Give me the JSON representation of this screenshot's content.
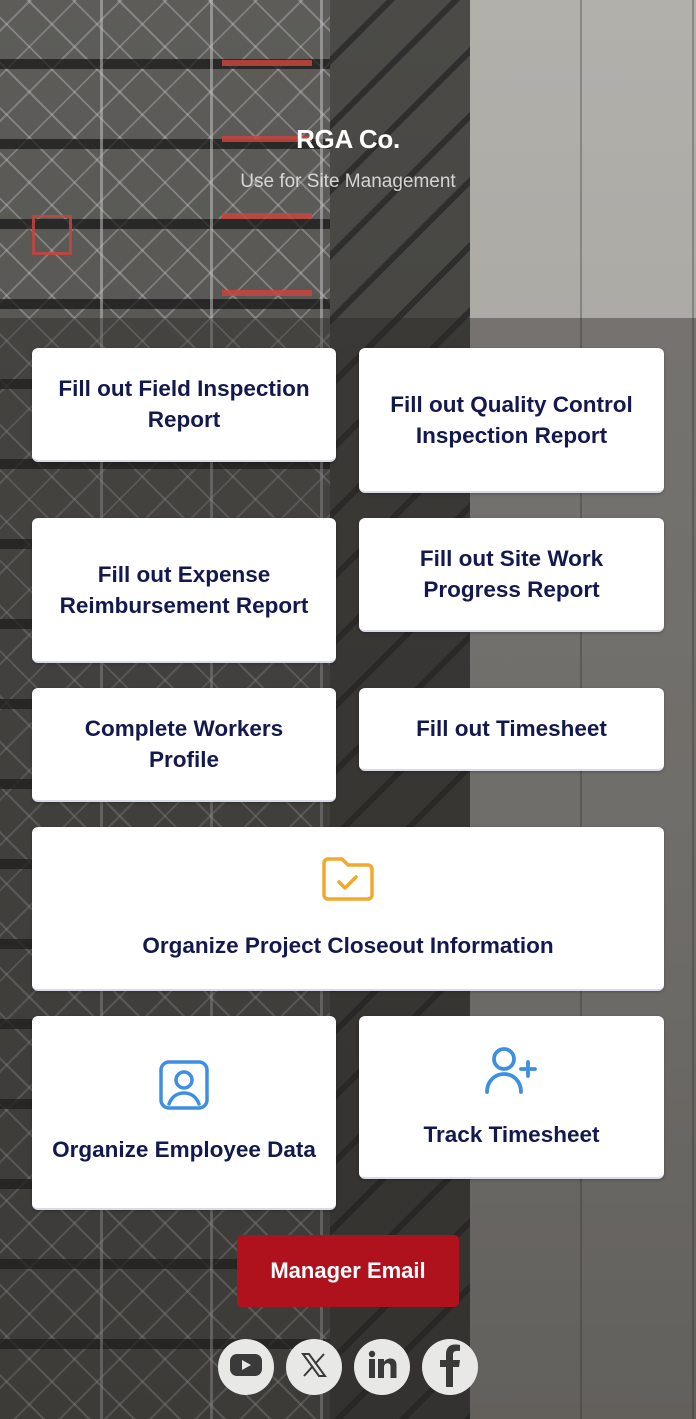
{
  "header": {
    "title": "RGA Co.",
    "subtitle": "Use for Site Management"
  },
  "buttons": [
    {
      "label": "Fill out Field Inspection Report",
      "icon": null
    },
    {
      "label": "Fill out Quality Control Inspection Report",
      "icon": null
    },
    {
      "label": "Fill out Expense Reimbursement Report",
      "icon": null
    },
    {
      "label": "Fill out Site Work Progress Report",
      "icon": null
    },
    {
      "label": "Complete Workers Profile",
      "icon": null
    },
    {
      "label": "Fill out Timesheet",
      "icon": null
    },
    {
      "label": "Organize Project Closeout Information",
      "icon": "folder-check-icon",
      "icon_color": "#f2a82c"
    },
    {
      "label": "Organize Employee Data",
      "icon": "user-portrait-icon",
      "icon_color": "#3f8fe0"
    },
    {
      "label": "Track Timesheet",
      "icon": "user-add-icon",
      "icon_color": "#3f8fe0"
    }
  ],
  "manager_button": {
    "label": "Manager Email",
    "color": "#b0121d"
  },
  "social": [
    {
      "name": "YouTube",
      "icon": "youtube-icon"
    },
    {
      "name": "X",
      "icon": "x-icon"
    },
    {
      "name": "LinkedIn",
      "icon": "linkedin-icon"
    },
    {
      "name": "Facebook",
      "icon": "facebook-icon"
    }
  ]
}
